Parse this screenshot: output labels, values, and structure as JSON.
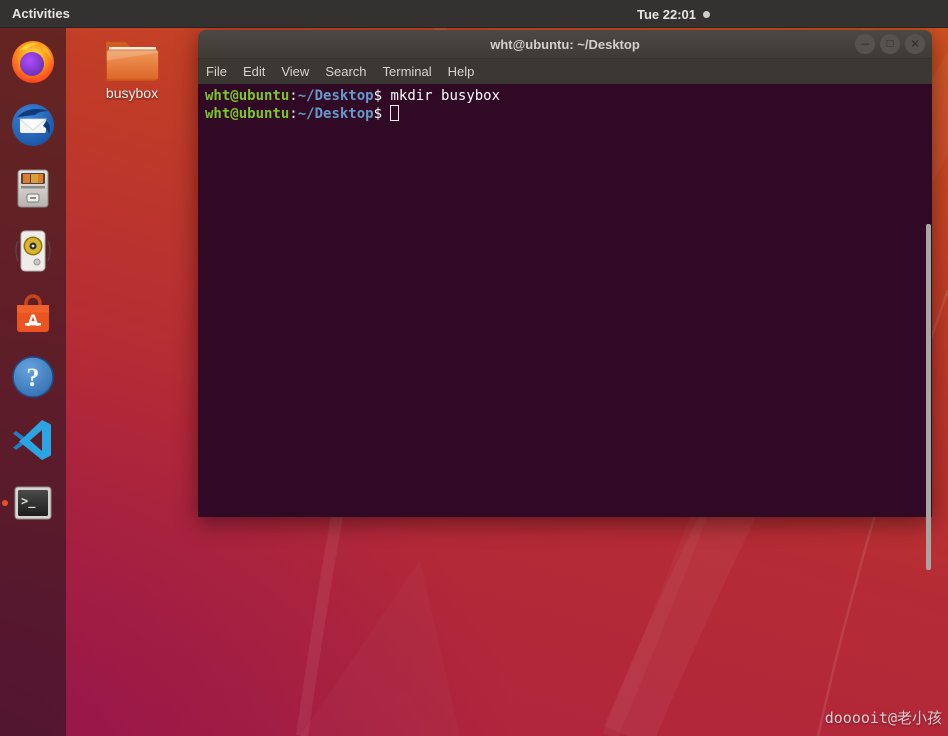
{
  "topbar": {
    "activities_label": "Activities",
    "clock": "Tue 22:01"
  },
  "dock": {
    "items": [
      "firefox",
      "thunderbird",
      "files",
      "rhythmbox",
      "ubuntu-software",
      "help",
      "vscode",
      "terminal"
    ],
    "running_item": "terminal",
    "software_letter": "A",
    "help_glyph": "?",
    "terminal_glyph": "&gt;_"
  },
  "desktop": {
    "folder_label": "busybox",
    "watermark": "dooooit@老小孩"
  },
  "terminal_window": {
    "title": "wht@ubuntu: ~/Desktop",
    "controls": {
      "minimize": "−",
      "maximize": "□",
      "close": "✕"
    },
    "menu": [
      "File",
      "Edit",
      "View",
      "Search",
      "Terminal",
      "Help"
    ],
    "lines": [
      {
        "user": "wht@ubuntu",
        "separator": ":",
        "path": "~/Desktop",
        "dollar": "$",
        "command": " mkdir busybox"
      },
      {
        "user": "wht@ubuntu",
        "separator": ":",
        "path": "~/Desktop",
        "dollar": "$",
        "command": ""
      }
    ],
    "colors": {
      "background": "#300a24",
      "user_green": "#7bc62e",
      "path_blue": "#6699cc",
      "text_white": "#ffffff"
    }
  }
}
